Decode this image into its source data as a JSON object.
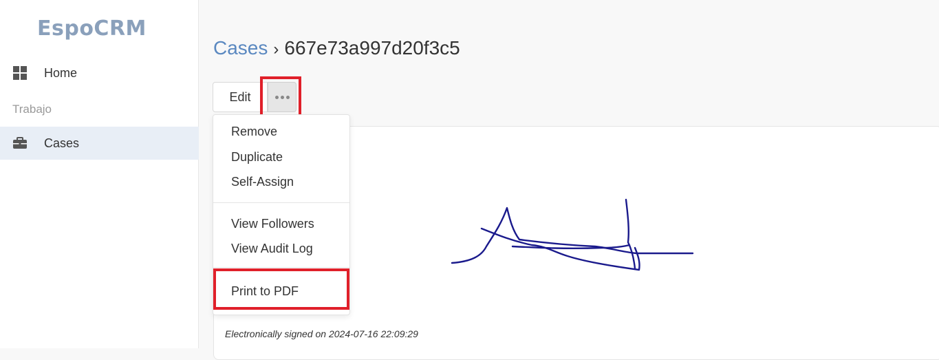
{
  "app": {
    "logo_text": "EspoCRM"
  },
  "sidebar": {
    "home_label": "Home",
    "group_label": "Trabajo",
    "cases_label": "Cases"
  },
  "header": {
    "breadcrumb_root": "Cases",
    "breadcrumb_separator": "›",
    "record_id": "667e73a997d20f3c5"
  },
  "toolbar": {
    "edit_label": "Edit",
    "more_icon": "ellipsis-icon"
  },
  "dropdown": {
    "items": [
      {
        "label": "Remove"
      },
      {
        "label": "Duplicate"
      },
      {
        "label": "Self-Assign"
      },
      {
        "label": "View Followers"
      },
      {
        "label": "View Audit Log"
      },
      {
        "label": "Print to PDF"
      }
    ]
  },
  "content": {
    "signed_note": "Electronically signed on 2024-07-16 22:09:29"
  },
  "colors": {
    "accent": "#5a88c0",
    "highlight": "#e0202a",
    "active_nav": "#e8eef6",
    "signature_ink": "#1a1a8c"
  }
}
